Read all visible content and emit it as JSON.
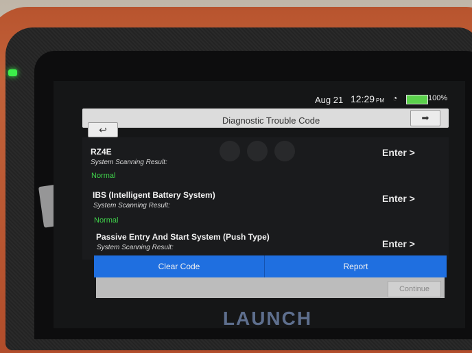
{
  "status_bar": {
    "date": "Aug 21",
    "time": "12:29",
    "ampm": "PM",
    "battery": "100%"
  },
  "header": {
    "title": "Diagnostic Trouble Code",
    "back_icon": "back-arrow-icon",
    "exit_icon": "exit-icon"
  },
  "systems": [
    {
      "name": "RZ4E",
      "sub": "System Scanning Result:",
      "status": "Normal",
      "enter": "Enter >"
    },
    {
      "name": "IBS (Intelligent Battery System)",
      "sub": "System Scanning Result:",
      "status": "Normal",
      "enter": "Enter >"
    },
    {
      "name": "Passive Entry And Start System (Push Type)",
      "sub": "System Scanning Result:",
      "status": "",
      "enter": "Enter >"
    }
  ],
  "actions": {
    "clear": "Clear Code",
    "report": "Report",
    "continue": "Continue"
  },
  "brand": "LAUNCH",
  "colors": {
    "accent": "#1f6fe0",
    "status_normal": "#3fd14a"
  }
}
